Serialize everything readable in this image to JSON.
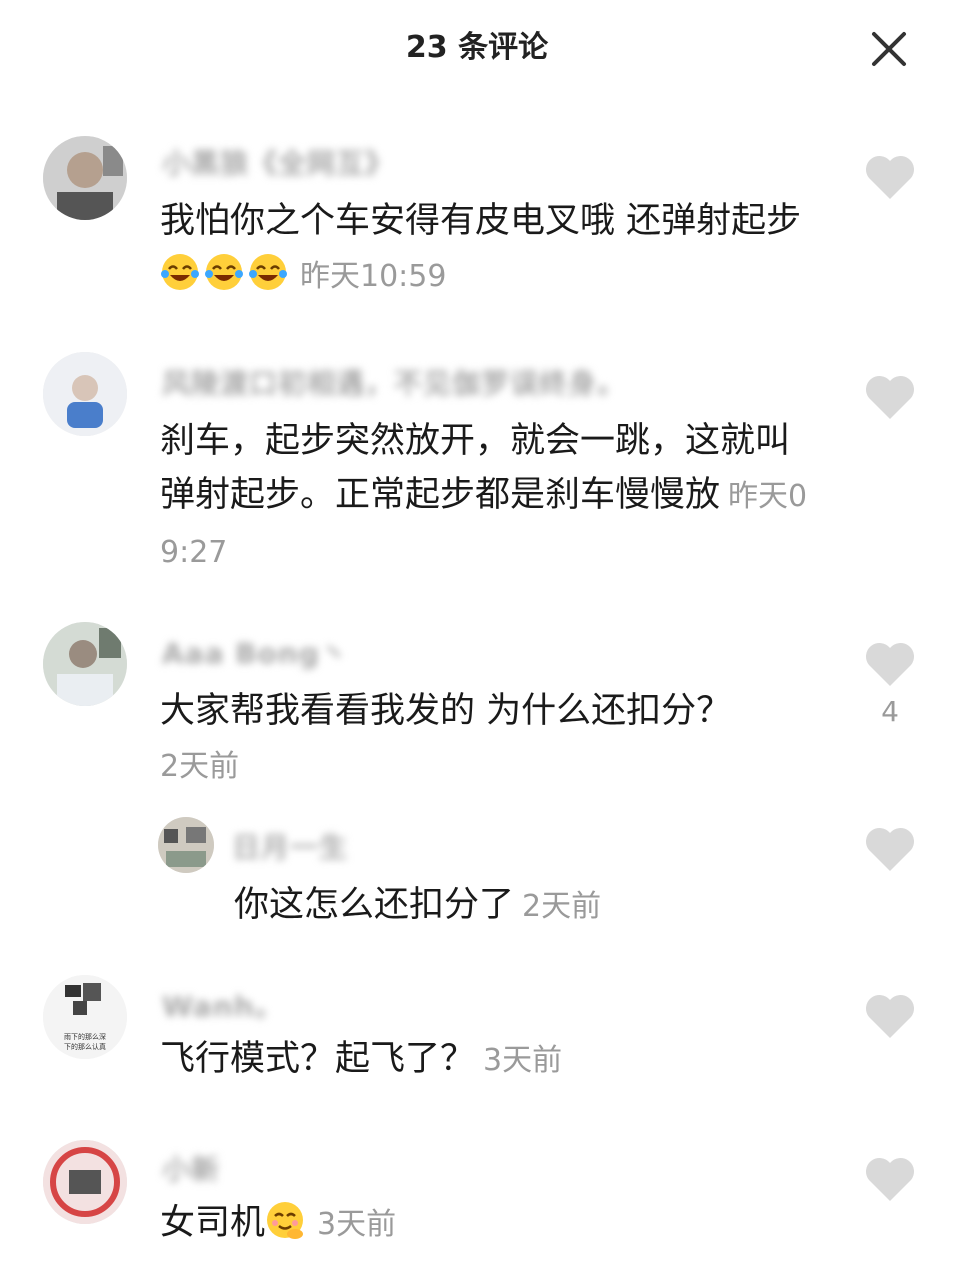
{
  "header": {
    "title": "23 条评论",
    "close_icon": "close-icon"
  },
  "comments": [
    {
      "username": "小黑狼《全网互》",
      "text": "我怕你之个车安得有皮电叉哦 还弹射起步",
      "time": "昨天10:59",
      "emojis": [
        "laughing-tears-emoji",
        "laughing-tears-emoji",
        "laughing-tears-emoji"
      ]
    },
    {
      "username": "风陵渡口初相遇，不见伽罗误终身。",
      "text": "刹车，起步突然放开，就会一跳，这就叫弹射起步。正常起步都是刹车慢慢放",
      "time": "昨天09:27"
    },
    {
      "username": "Aaa Bong丶",
      "text": "大家帮我看看我发的 为什么还扣分？",
      "time": "2天前",
      "likes": "4"
    },
    {
      "username": "日月一生",
      "text": "你这怎么还扣分了",
      "time": "2天前",
      "is_reply": true
    },
    {
      "username": "Wanh。",
      "text": "飞行模式？起飞了？",
      "time": "3天前",
      "avatar_caption": [
        "雨下的那么深",
        "下的那么认真"
      ]
    },
    {
      "username": "小新",
      "text": "女司机",
      "time": "3天前",
      "emojis": [
        "shy-smile-emoji"
      ]
    }
  ],
  "colors": {
    "heart": "#d9d9d9",
    "meta": "#9a9a9a",
    "text": "#1a1a1a"
  }
}
